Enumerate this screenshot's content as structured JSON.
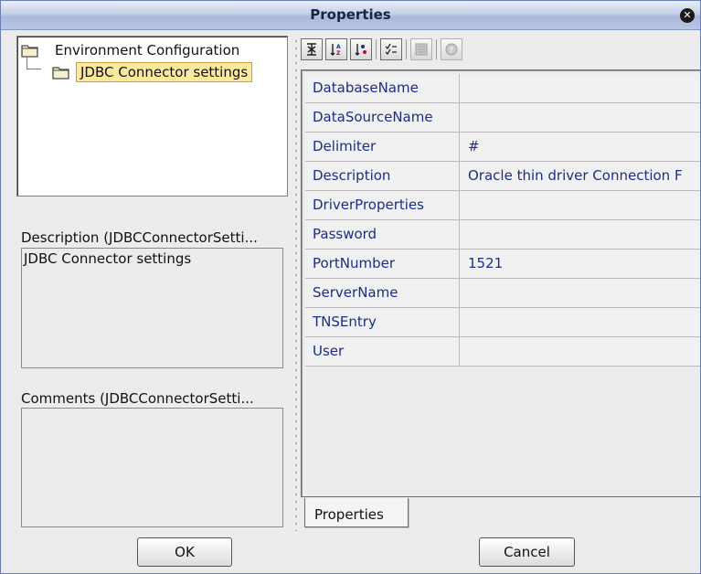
{
  "window": {
    "title": "Properties",
    "close_icon": "close-icon"
  },
  "tree": {
    "root_label": "Environment Configuration",
    "child_label": "JDBC Connector settings"
  },
  "description": {
    "label": "Description (JDBCConnectorSetti...",
    "text": "JDBC Connector settings"
  },
  "comments": {
    "label": "Comments (JDBCConnectorSetti...",
    "text": ""
  },
  "toolbar": {
    "icons": [
      "categorize-icon",
      "sort-alpha-icon",
      "sort-category-icon",
      "checklist-icon",
      "list-icon",
      "help-icon"
    ]
  },
  "properties": [
    {
      "name": "DatabaseName",
      "value": ""
    },
    {
      "name": "DataSourceName",
      "value": ""
    },
    {
      "name": "Delimiter",
      "value": "#"
    },
    {
      "name": "Description",
      "value": "Oracle thin driver Connection F"
    },
    {
      "name": "DriverProperties",
      "value": ""
    },
    {
      "name": "Password",
      "value": ""
    },
    {
      "name": "PortNumber",
      "value": "1521"
    },
    {
      "name": "ServerName",
      "value": ""
    },
    {
      "name": "TNSEntry",
      "value": ""
    },
    {
      "name": "User",
      "value": ""
    }
  ],
  "tab": {
    "label": "Properties"
  },
  "buttons": {
    "ok_label": "OK",
    "cancel_label": "Cancel"
  },
  "colors": {
    "property_text": "#1a2e85",
    "selection_bg": "#fde99e"
  }
}
